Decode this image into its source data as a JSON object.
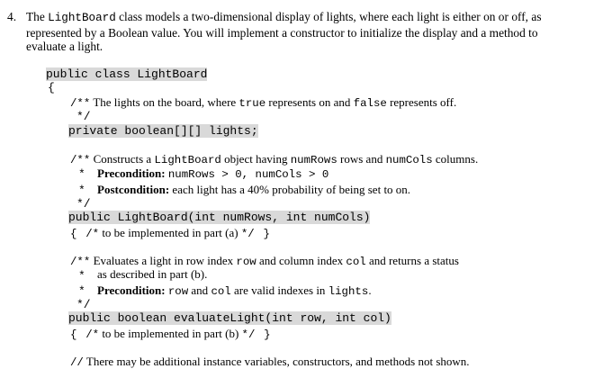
{
  "question": {
    "number": "4.",
    "intro_p1": "The ",
    "intro_class": "LightBoard",
    "intro_p2": " class models a two-dimensional display of lights, where each light is either on or off, as",
    "intro_line2": "represented by a Boolean value. You will implement a constructor to initialize the display and a method to",
    "intro_line3": "evaluate a light."
  },
  "code": {
    "class_decl": "public class LightBoard",
    "open_brace": "{",
    "field_comment_start": "/**",
    "field_comment_p1": " The lights on the board, where ",
    "field_comment_true": "true",
    "field_comment_p2": " represents on and ",
    "field_comment_false": "false",
    "field_comment_p3": " represents off.",
    "comment_end": "*/",
    "field_decl": "private boolean[][] lights;",
    "ctor_comment_start": "/**",
    "ctor_comment_p1": " Constructs a ",
    "ctor_comment_class": "LightBoard",
    "ctor_comment_p2": " object having ",
    "ctor_comment_rows": "numRows",
    "ctor_comment_p3": " rows and ",
    "ctor_comment_cols": "numCols",
    "ctor_comment_p4": " columns.",
    "star": "*",
    "ctor_pre_label": "Precondition:",
    "ctor_pre_code": "numRows > 0, numCols > 0",
    "ctor_post_label": "Postcondition:",
    "ctor_post_text": " each light has a 40% probability of being set to on.",
    "ctor_decl": "public LightBoard(int numRows, int numCols)",
    "ctor_body_brace_open": "{",
    "ctor_body_comment_open": "/*",
    "ctor_body_text": " to be implemented in part (a) ",
    "ctor_body_comment_close": "*/",
    "ctor_body_brace_close": "}",
    "eval_comment_start": "/**",
    "eval_comment_p1": " Evaluates a light in row index ",
    "eval_comment_row": "row",
    "eval_comment_p2": " and column index ",
    "eval_comment_col": "col",
    "eval_comment_p3": " and returns a status",
    "eval_comment_line2": "as described in part (b).",
    "eval_pre_label": "Precondition:",
    "eval_pre_row": "row",
    "eval_pre_and": " and ",
    "eval_pre_col": "col",
    "eval_pre_text": " are valid indexes in ",
    "eval_pre_lights": "lights",
    "eval_pre_end": ".",
    "eval_decl": "public boolean evaluateLight(int row, int col)",
    "eval_body_brace_open": "{",
    "eval_body_comment_open": "/*",
    "eval_body_text": " to be implemented in part (b) ",
    "eval_body_comment_close": "*/",
    "eval_body_brace_close": "}",
    "final_comment_slashes": "//",
    "final_comment_text": " There may be additional instance variables, constructors, and methods not shown."
  }
}
